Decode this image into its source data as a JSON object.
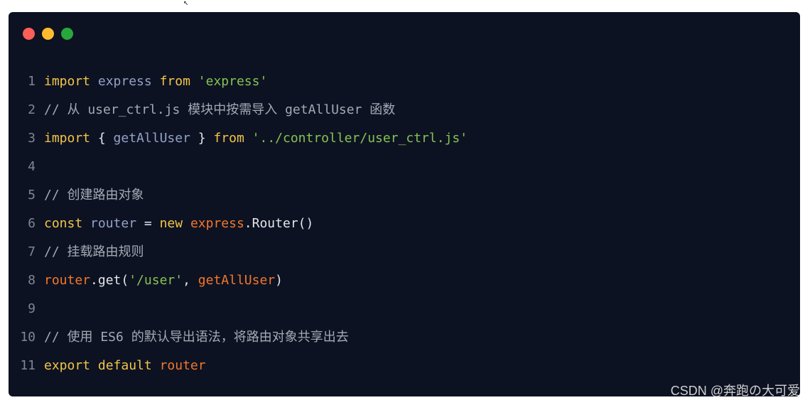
{
  "window": {
    "controls": [
      "close",
      "minimize",
      "maximize"
    ]
  },
  "code": {
    "language": "javascript",
    "lines": [
      {
        "number": "1",
        "tokens": [
          {
            "t": "import",
            "c": "kw"
          },
          {
            "t": " ",
            "c": "plain"
          },
          {
            "t": "express",
            "c": "id"
          },
          {
            "t": " ",
            "c": "plain"
          },
          {
            "t": "from",
            "c": "kw"
          },
          {
            "t": " ",
            "c": "plain"
          },
          {
            "t": "'express'",
            "c": "str"
          }
        ]
      },
      {
        "number": "2",
        "tokens": [
          {
            "t": "// 从 user_ctrl.js 模块中按需导入 getAllUser 函数",
            "c": "cm"
          }
        ]
      },
      {
        "number": "3",
        "tokens": [
          {
            "t": "import",
            "c": "kw"
          },
          {
            "t": " { ",
            "c": "plain"
          },
          {
            "t": "getAllUser",
            "c": "id"
          },
          {
            "t": " } ",
            "c": "plain"
          },
          {
            "t": "from",
            "c": "kw"
          },
          {
            "t": " ",
            "c": "plain"
          },
          {
            "t": "'../controller/user_ctrl.js'",
            "c": "str"
          }
        ]
      },
      {
        "number": "4",
        "tokens": []
      },
      {
        "number": "5",
        "tokens": [
          {
            "t": "// 创建路由对象",
            "c": "cm"
          }
        ]
      },
      {
        "number": "6",
        "tokens": [
          {
            "t": "const",
            "c": "kw"
          },
          {
            "t": " ",
            "c": "plain"
          },
          {
            "t": "router",
            "c": "id"
          },
          {
            "t": " = ",
            "c": "plain"
          },
          {
            "t": "new",
            "c": "kw"
          },
          {
            "t": " ",
            "c": "plain"
          },
          {
            "t": "express",
            "c": "fn"
          },
          {
            "t": ".Router()",
            "c": "plain"
          }
        ]
      },
      {
        "number": "7",
        "tokens": [
          {
            "t": "// 挂载路由规则",
            "c": "cm"
          }
        ]
      },
      {
        "number": "8",
        "tokens": [
          {
            "t": "router",
            "c": "fn"
          },
          {
            "t": ".get(",
            "c": "plain"
          },
          {
            "t": "'/user'",
            "c": "str"
          },
          {
            "t": ", ",
            "c": "plain"
          },
          {
            "t": "getAllUser",
            "c": "fn"
          },
          {
            "t": ")",
            "c": "plain"
          }
        ]
      },
      {
        "number": "9",
        "tokens": []
      },
      {
        "number": "10",
        "tokens": [
          {
            "t": "// 使用 ES6 的默认导出语法，将路由对象共享出去",
            "c": "cm"
          }
        ]
      },
      {
        "number": "11",
        "tokens": [
          {
            "t": "export",
            "c": "kw"
          },
          {
            "t": " ",
            "c": "plain"
          },
          {
            "t": "default",
            "c": "kw"
          },
          {
            "t": " ",
            "c": "plain"
          },
          {
            "t": "router",
            "c": "fn"
          }
        ]
      }
    ]
  },
  "watermark": "CSDN @奔跑の大可爱",
  "colors": {
    "background": "#0d1222",
    "keyword": "#f2c548",
    "identifier": "#93a2c8",
    "string": "#86c254",
    "comment": "#a4a9b5",
    "function": "#f3772a",
    "line_number": "#7f8594"
  }
}
